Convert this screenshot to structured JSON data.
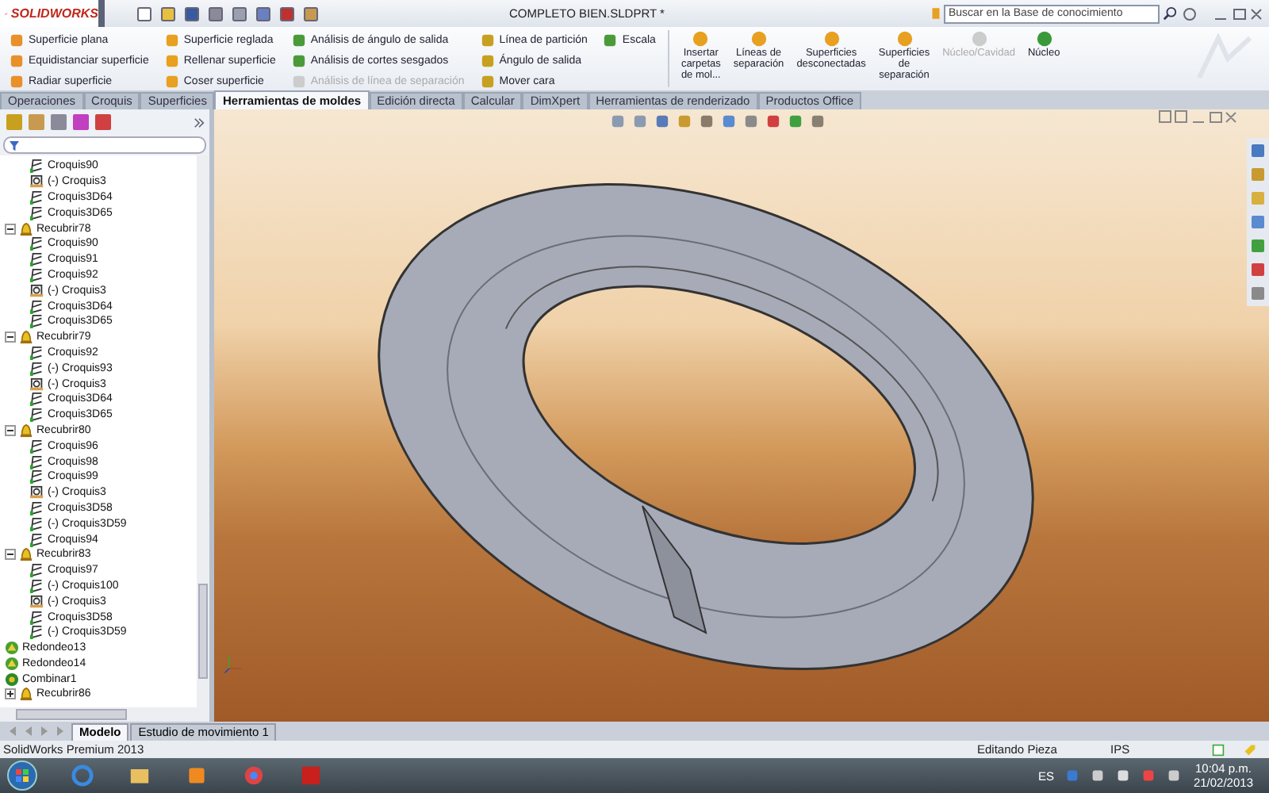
{
  "app": {
    "logo": "SOLIDWORKS"
  },
  "window": {
    "title": "COMPLETO BIEN.SLDPRT *"
  },
  "search": {
    "placeholder": "Buscar en la Base de conocimiento"
  },
  "ribbon": {
    "columns": [
      [
        {
          "label": "Superficie plana",
          "disabled": false
        },
        {
          "label": "Equidistanciar superficie",
          "disabled": false
        },
        {
          "label": "Radiar superficie",
          "disabled": false
        }
      ],
      [
        {
          "label": "Superficie reglada",
          "disabled": false
        },
        {
          "label": "Rellenar superficie",
          "disabled": false
        },
        {
          "label": "Coser superficie",
          "disabled": false
        }
      ],
      [
        {
          "label": "Análisis de ángulo de salida",
          "disabled": false
        },
        {
          "label": "Análisis de cortes sesgados",
          "disabled": false
        },
        {
          "label": "Análisis de línea de separación",
          "disabled": true
        }
      ],
      [
        {
          "label": "Línea de partición",
          "disabled": false
        },
        {
          "label": "Ángulo de salida",
          "disabled": false
        },
        {
          "label": "Mover cara",
          "disabled": false
        }
      ],
      [
        {
          "label": "Escala",
          "disabled": false
        }
      ]
    ],
    "large_buttons": [
      {
        "label": "Insertar\ncarpetas\nde mol...",
        "disabled": false
      },
      {
        "label": "Líneas de\nseparación",
        "disabled": false
      },
      {
        "label": "Superficies\ndesconectadas",
        "disabled": false
      },
      {
        "label": "Superficies\nde\nseparación",
        "disabled": false
      },
      {
        "label": "Núcleo/Cavidad",
        "disabled": true
      },
      {
        "label": "Núcleo",
        "disabled": false
      }
    ]
  },
  "tabs": [
    {
      "label": "Operaciones",
      "selected": false
    },
    {
      "label": "Croquis",
      "selected": false
    },
    {
      "label": "Superficies",
      "selected": false
    },
    {
      "label": "Herramientas de moldes",
      "selected": true
    },
    {
      "label": "Edición directa",
      "selected": false
    },
    {
      "label": "Calcular",
      "selected": false
    },
    {
      "label": "DimXpert",
      "selected": false
    },
    {
      "label": "Herramientas de renderizado",
      "selected": false
    },
    {
      "label": "Productos Office",
      "selected": false
    }
  ],
  "tree": {
    "continued_children": [
      {
        "label": "Croquis90",
        "kind": "sketch"
      },
      {
        "label": "(-) Croquis3",
        "kind": "sketch3d"
      },
      {
        "label": "Croquis3D64",
        "kind": "sketch"
      },
      {
        "label": "Croquis3D65",
        "kind": "sketch"
      }
    ],
    "items": [
      {
        "label": "Recubrir78",
        "kind": "loft",
        "expanded": true,
        "children": [
          {
            "label": "Croquis90",
            "kind": "sketch"
          },
          {
            "label": "Croquis91",
            "kind": "sketch"
          },
          {
            "label": "Croquis92",
            "kind": "sketch"
          },
          {
            "label": "(-) Croquis3",
            "kind": "sketch3d"
          },
          {
            "label": "Croquis3D64",
            "kind": "sketch"
          },
          {
            "label": "Croquis3D65",
            "kind": "sketch"
          }
        ]
      },
      {
        "label": "Recubrir79",
        "kind": "loft",
        "expanded": true,
        "children": [
          {
            "label": "Croquis92",
            "kind": "sketch"
          },
          {
            "label": "(-) Croquis93",
            "kind": "sketch"
          },
          {
            "label": "(-) Croquis3",
            "kind": "sketch3d"
          },
          {
            "label": "Croquis3D64",
            "kind": "sketch"
          },
          {
            "label": "Croquis3D65",
            "kind": "sketch"
          }
        ]
      },
      {
        "label": "Recubrir80",
        "kind": "loft",
        "expanded": true,
        "children": [
          {
            "label": "Croquis96",
            "kind": "sketch"
          },
          {
            "label": "Croquis98",
            "kind": "sketch"
          },
          {
            "label": "Croquis99",
            "kind": "sketch"
          },
          {
            "label": "(-) Croquis3",
            "kind": "sketch3d"
          },
          {
            "label": "Croquis3D58",
            "kind": "sketch"
          },
          {
            "label": "(-) Croquis3D59",
            "kind": "sketch"
          },
          {
            "label": "Croquis94",
            "kind": "sketch"
          }
        ]
      },
      {
        "label": "Recubrir83",
        "kind": "loft",
        "expanded": true,
        "children": [
          {
            "label": "Croquis97",
            "kind": "sketch"
          },
          {
            "label": "(-) Croquis100",
            "kind": "sketch"
          },
          {
            "label": "(-) Croquis3",
            "kind": "sketch3d"
          },
          {
            "label": "Croquis3D58",
            "kind": "sketch"
          },
          {
            "label": "(-) Croquis3D59",
            "kind": "sketch"
          }
        ]
      },
      {
        "label": "Redondeo13",
        "kind": "fillet"
      },
      {
        "label": "Redondeo14",
        "kind": "fillet"
      },
      {
        "label": "Combinar1",
        "kind": "combine"
      },
      {
        "label": "Recubrir86",
        "kind": "loft",
        "expanded": false
      }
    ]
  },
  "bottom_tabs": [
    {
      "label": "Modelo",
      "selected": true
    },
    {
      "label": "Estudio de movimiento 1",
      "selected": false
    }
  ],
  "status_bar": {
    "product": "SolidWorks Premium 2013",
    "mode": "Editando Pieza",
    "units": "IPS"
  },
  "taskbar": {
    "language": "ES",
    "time": "10:04 p.m.",
    "date": "21/02/2013"
  }
}
